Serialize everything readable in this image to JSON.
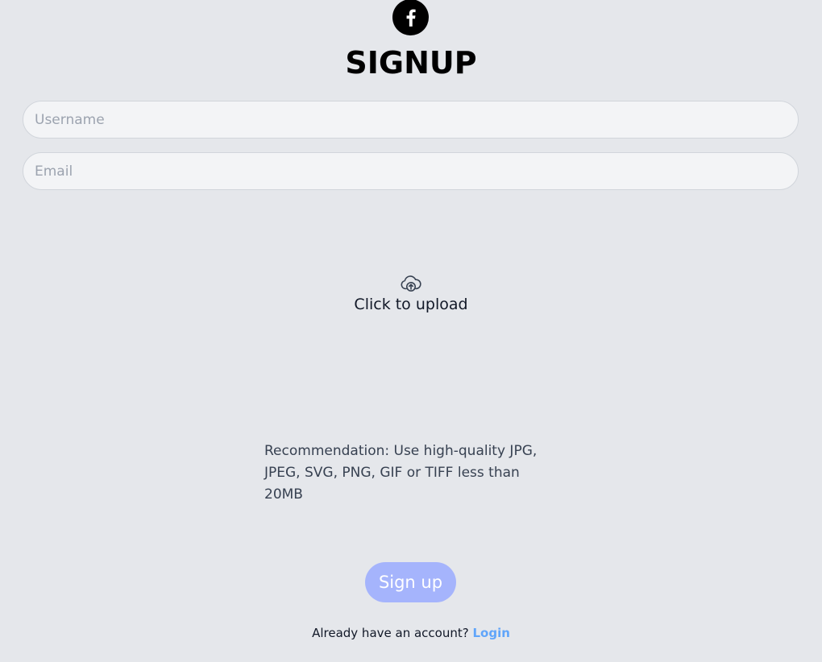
{
  "logo": {
    "icon": "facebook-logo-icon"
  },
  "title": "SIGNUP",
  "form": {
    "username_placeholder": "Username",
    "username_value": "",
    "email_placeholder": "Email",
    "email_value": ""
  },
  "upload": {
    "icon": "cloud-upload-icon",
    "label": "Click to upload"
  },
  "recommendation": {
    "line1": "Recommendation: Use high-quality JPG,",
    "line2": "JPEG, SVG, PNG, GIF or TIFF less than 20MB"
  },
  "signup_button": "Sign up",
  "footer": {
    "text": "Already have an account?",
    "link": "Login"
  },
  "colors": {
    "background": "#e5e7eb",
    "field_background": "#f3f4f6",
    "button": "#a5b4fc",
    "link": "#60a5fa"
  }
}
